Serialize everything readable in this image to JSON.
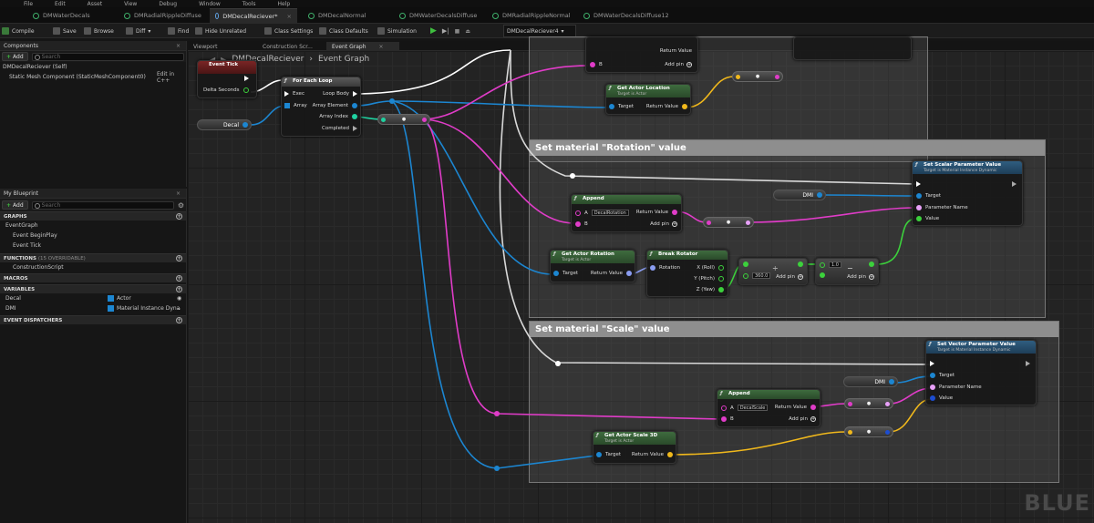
{
  "menu": [
    "File",
    "Edit",
    "Asset",
    "View",
    "Debug",
    "Window",
    "Tools",
    "Help"
  ],
  "tabs": [
    {
      "label": "DMWaterDecals",
      "active": false
    },
    {
      "label": "DMRadialRippleDiffuse",
      "active": false
    },
    {
      "label": "DMDecalReciever*",
      "active": true
    },
    {
      "label": "DMDecalNormal",
      "active": false
    },
    {
      "label": "DMWaterDecalsDiffuse",
      "active": false
    },
    {
      "label": "DMRadialRippleNormal",
      "active": false
    },
    {
      "label": "DMWaterDecalsDiffuse12",
      "active": false
    }
  ],
  "toolbar": {
    "compile": "Compile",
    "save": "Save",
    "browse": "Browse",
    "diff": "Diff",
    "find": "Find",
    "hide_unrelated": "Hide Unrelated",
    "class_settings": "Class Settings",
    "class_defaults": "Class Defaults",
    "simulation": "Simulation",
    "debug_object": "DMDecalReciever4"
  },
  "components": {
    "title": "Components",
    "add": "Add",
    "search_placeholder": "Search",
    "root": "DMDecalReciever (Self)",
    "child": "Static Mesh Component (StaticMeshComponent0)",
    "edit_link": "Edit in C++"
  },
  "my_blueprint": {
    "title": "My Blueprint",
    "add": "Add",
    "search_placeholder": "Search",
    "graphs_header": "GRAPHS",
    "graph": "EventGraph",
    "events": [
      "Event BeginPlay",
      "Event Tick"
    ],
    "functions_header": "FUNCTIONS",
    "functions_note": "(15 OVERRIDABLE)",
    "function": "ConstructionScript",
    "macros_header": "MACROS",
    "variables_header": "VARIABLES",
    "variables": [
      {
        "name": "Decal",
        "type": "Actor",
        "color": "#1c86d1"
      },
      {
        "name": "DMI",
        "type": "Material Instance Dyna",
        "color": "#1c86d1"
      }
    ],
    "dispatchers_header": "EVENT DISPATCHERS"
  },
  "graph_tabs": [
    "Viewport",
    "Construction Scr...",
    "Event Graph"
  ],
  "breadcrumb": {
    "blueprint": "DMDecalReciever",
    "graph": "Event Graph"
  },
  "comments": {
    "rotation": "Set material \"Rotation\" value",
    "scale": "Set material \"Scale\" value"
  },
  "nodes": {
    "event_tick": {
      "title": "Event Tick",
      "pin": "Delta Seconds"
    },
    "decal_var": "Decal",
    "for_each": {
      "title": "For Each Loop",
      "exec": "Exec",
      "array": "Array",
      "loop_body": "Loop Body",
      "array_element": "Array Element",
      "array_index": "Array Index",
      "completed": "Completed"
    },
    "get_location": {
      "title": "Get Actor Location",
      "sub": "Target is Actor",
      "target": "Target",
      "ret": "Return Value"
    },
    "top_partial": {
      "ret": "Return Value",
      "b": "B",
      "add": "Add pin"
    },
    "set_scalar": {
      "title": "Set Scalar Parameter Value",
      "sub": "Target is Material Instance Dynamic",
      "target": "Target",
      "param": "Parameter Name",
      "value": "Value"
    },
    "dmi1": "DMI",
    "append1": {
      "title": "Append",
      "a": "A",
      "a_val": "DecalRotation",
      "b": "B",
      "ret": "Return Value",
      "add": "Add pin"
    },
    "get_rotation": {
      "title": "Get Actor Rotation",
      "sub": "Target is Actor",
      "target": "Target",
      "ret": "Return Value"
    },
    "break_rot": {
      "title": "Break Rotator",
      "rotation": "Rotation",
      "x": "X (Roll)",
      "y": "Y (Pitch)",
      "z": "Z (Yaw)"
    },
    "divide": {
      "val": "360.0",
      "op": "÷",
      "add": "Add pin"
    },
    "subtract": {
      "val": "1.0",
      "op": "−",
      "add": "Add pin"
    },
    "set_vector": {
      "title": "Set Vector Parameter Value",
      "sub": "Target is Material Instance Dynamic",
      "target": "Target",
      "param": "Parameter Name",
      "value": "Value"
    },
    "dmi2": "DMI",
    "append2": {
      "title": "Append",
      "a": "A",
      "a_val": "DecalScale",
      "b": "B",
      "ret": "Return Value",
      "add": "Add pin"
    },
    "get_scale": {
      "title": "Get Actor Scale 3D",
      "sub": "Target is Actor",
      "target": "Target",
      "ret": "Return Value"
    }
  },
  "watermark": "BLUE",
  "colors": {
    "exec": "#ffffff",
    "object": "#1c86d1",
    "string": "#e03cc8",
    "float": "#3cd13c",
    "vector": "#f0b81c",
    "rotator": "#8a9cf0",
    "int": "#1fd1a0"
  }
}
